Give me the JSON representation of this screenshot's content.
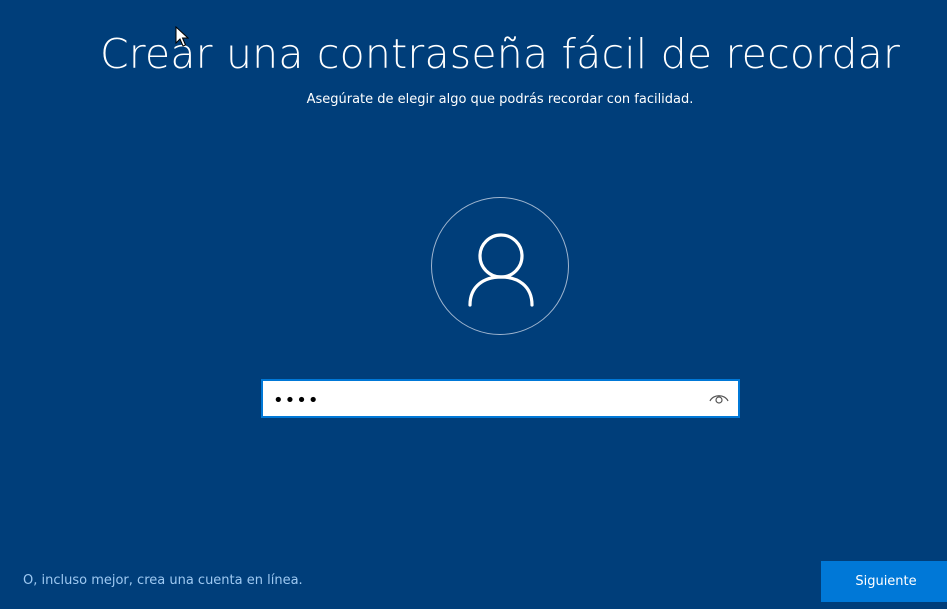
{
  "header": {
    "title": "Crear una contraseña fácil de recordar",
    "subtitle": "Asegúrate de elegir algo que podrás recordar con facilidad."
  },
  "avatar": {
    "icon": "user-icon"
  },
  "password": {
    "value": "abcd",
    "type": "password",
    "reveal_icon": "eye-icon"
  },
  "footer": {
    "online_account_link": "O, incluso mejor, crea una cuenta en línea.",
    "next_button": "Siguiente"
  },
  "colors": {
    "background": "#003e7a",
    "accent": "#0078d7",
    "link": "#9ec9f2"
  }
}
